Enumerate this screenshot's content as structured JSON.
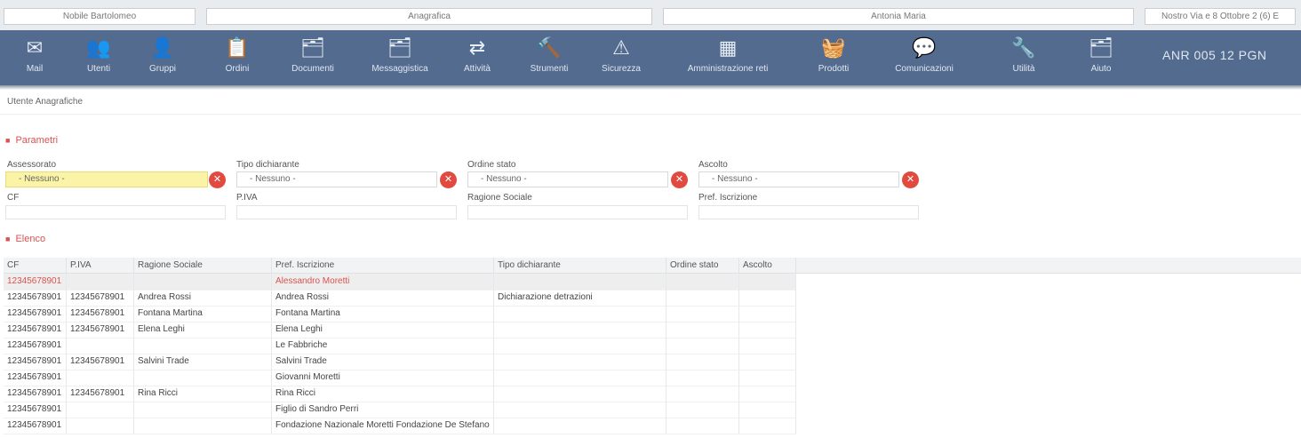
{
  "topbar": {
    "boxes": [
      "Nobile Bartolomeo",
      "Anagrafica",
      "Antonia Maria",
      "Nostro Via e 8 Ottobre 2 (6) E"
    ]
  },
  "toolbar": {
    "items": [
      {
        "label": "Mail",
        "icon": "envelope-icon",
        "glyph": "✉"
      },
      {
        "label": "Utenti",
        "icon": "users-icon",
        "glyph": "👥"
      },
      {
        "label": "Gruppi",
        "icon": "user-icon",
        "glyph": "👤"
      },
      {
        "label": "Ordini",
        "icon": "clipboard-icon",
        "glyph": "📋"
      },
      {
        "label": "Documenti",
        "icon": "documents-icon",
        "glyph": "🗂"
      },
      {
        "label": "Messaggistica",
        "icon": "messages-icon",
        "glyph": "🗂"
      },
      {
        "label": "Attività",
        "icon": "exchange-icon",
        "glyph": "⇄"
      },
      {
        "label": "Strumenti",
        "icon": "gavel-icon",
        "glyph": "🔨"
      },
      {
        "label": "Sicurezza",
        "icon": "warning-icon",
        "glyph": "⚠"
      },
      {
        "label": "Amministrazione reti",
        "icon": "grid-icon",
        "glyph": "▦"
      },
      {
        "label": "Prodotti",
        "icon": "basket-icon",
        "glyph": "🧺"
      },
      {
        "label": "Comunicazioni",
        "icon": "chat-icon",
        "glyph": "💬"
      },
      {
        "label": "Utilità",
        "icon": "wrench-icon",
        "glyph": "🔧"
      },
      {
        "label": "Aiuto",
        "icon": "help-icon",
        "glyph": "🗂"
      }
    ],
    "org_code": "ANR 005 12 PGN"
  },
  "breadcrumb": "Utente Anagrafiche",
  "filters_section": {
    "title": "Parametri",
    "selects": [
      {
        "label": "Assessorato",
        "value": "- Nessuno -"
      },
      {
        "label": "Tipo dichiarante",
        "value": "- Nessuno -"
      },
      {
        "label": "Ordine stato",
        "value": "- Nessuno -"
      },
      {
        "label": "Ascolto",
        "value": "- Nessuno -"
      }
    ],
    "inputs": [
      {
        "label": "CF"
      },
      {
        "label": "P.IVA"
      },
      {
        "label": "Ragione Sociale"
      },
      {
        "label": "Pref. Iscrizione"
      }
    ]
  },
  "results_section": {
    "title": "Elenco",
    "columns": [
      "CF",
      "P.IVA",
      "Ragione Sociale",
      "Pref. Iscrizione",
      "Tipo dichiarante",
      "Ordine stato",
      "Ascolto"
    ],
    "rows": [
      [
        "12345678901",
        "",
        "",
        "Alessandro Moretti",
        "",
        "",
        ""
      ],
      [
        "12345678901",
        "12345678901",
        "Andrea Rossi",
        "Andrea Rossi",
        "Dichiarazione detrazioni",
        "",
        ""
      ],
      [
        "12345678901",
        "12345678901",
        "Fontana Martina",
        "Fontana Martina",
        "",
        "",
        ""
      ],
      [
        "12345678901",
        "12345678901",
        "Elena Leghi",
        "Elena Leghi",
        "",
        "",
        ""
      ],
      [
        "12345678901",
        "",
        "",
        "Le Fabbriche",
        "",
        "",
        ""
      ],
      [
        "12345678901",
        "12345678901",
        "Salvini Trade",
        "Salvini Trade",
        "",
        "",
        ""
      ],
      [
        "12345678901",
        "",
        "",
        "Giovanni Moretti",
        "",
        "",
        ""
      ],
      [
        "12345678901",
        "12345678901",
        "Rina Ricci",
        "Rina Ricci",
        "",
        "",
        ""
      ],
      [
        "12345678901",
        "",
        "",
        "Figlio di Sandro Perri",
        "",
        "",
        ""
      ],
      [
        "12345678901",
        "",
        "",
        "Fondazione Nazionale Moretti Fondazione De Stefano",
        "",
        "",
        ""
      ]
    ]
  }
}
